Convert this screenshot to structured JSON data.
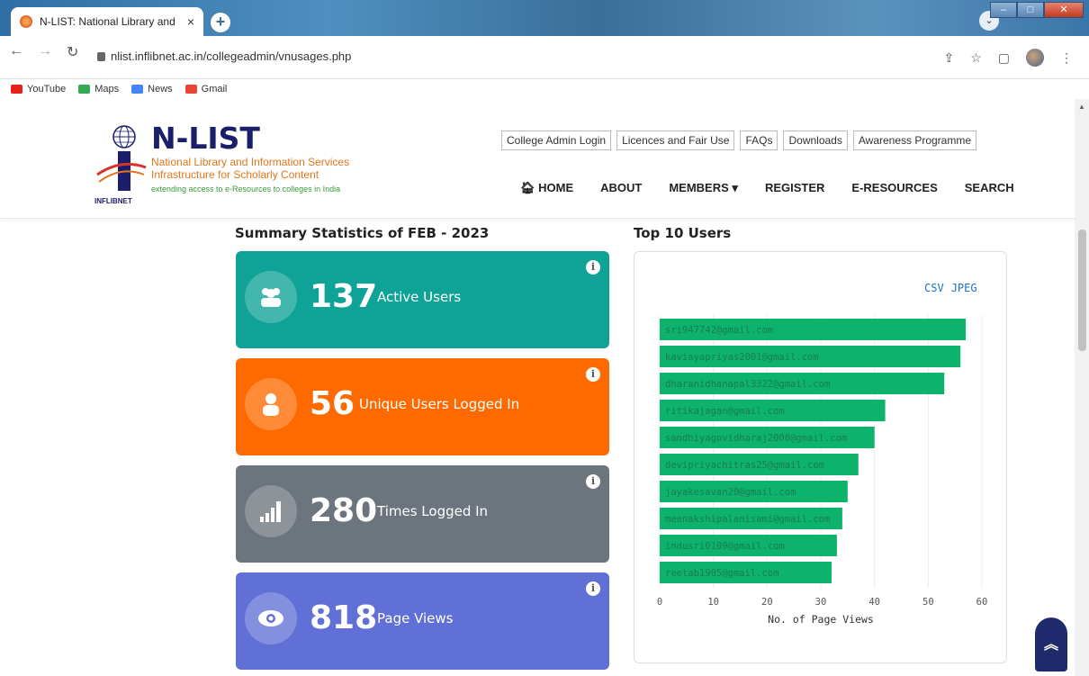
{
  "browser": {
    "tab_title": "N-LIST: National Library and Info",
    "tab_close": "×",
    "new_tab": "+",
    "url": "nlist.inflibnet.ac.in/collegeadmin/vnusages.php",
    "bookmarks": [
      {
        "label": "YouTube",
        "icon": "youtube-icon",
        "color": "#e62117"
      },
      {
        "label": "Maps",
        "icon": "maps-icon",
        "color": "#34a853"
      },
      {
        "label": "News",
        "icon": "news-icon",
        "color": "#4285f4"
      },
      {
        "label": "Gmail",
        "icon": "gmail-icon",
        "color": "#ea4335"
      }
    ]
  },
  "site": {
    "brand_name": "N-LIST",
    "brand_line1": "National Library and Information Services",
    "brand_line2": "Infrastructure for Scholarly Content",
    "brand_tagline": "extending access to e-Resources to colleges in India",
    "logo_text": "INFLIBNET",
    "top_links": [
      "College Admin Login",
      "Licences and Fair Use",
      "FAQs",
      "Downloads",
      "Awareness Programme"
    ],
    "nav": {
      "home": "HOME",
      "about": "ABOUT",
      "members": "MEMBERS ▾",
      "register": "REGISTER",
      "eresources": "E-RESOURCES",
      "search": "SEARCH"
    }
  },
  "summary": {
    "title": "Summary Statistics of FEB - 2023",
    "cards": [
      {
        "value": "137",
        "label": "Active Users",
        "color": "#0fa397",
        "icon": "users-icon"
      },
      {
        "value": "56",
        "label": "Unique Users Logged In",
        "color": "#ff6a00",
        "icon": "user-icon"
      },
      {
        "value": "280",
        "label": "Times Logged In",
        "color": "#6c757d",
        "icon": "signal-icon"
      },
      {
        "value": "818",
        "label": "Page Views",
        "color": "#6170d6",
        "icon": "eye-icon"
      }
    ],
    "info_glyph": "i"
  },
  "top_users": {
    "title": "Top 10 Users",
    "csv_label": "CSV",
    "jpeg_label": "JPEG"
  },
  "chart_data": {
    "type": "bar",
    "orientation": "horizontal",
    "categories": [
      "sri947742@gmail.com",
      "kaviayapriyas2001@gmail.com",
      "dharanidhanapal3322@gmail.com",
      "ritikajagan@gmail.com",
      "sandhiyagovidharaj2000@gmail.com",
      "devipriyachitras25@gmail.com",
      "jayakesavan20@gmail.com",
      "meenakshipalanisami@gmail.com",
      "indusri0109@gmail.com",
      "reetab1905@gmail.com"
    ],
    "values": [
      57,
      56,
      53,
      42,
      40,
      37,
      35,
      34,
      33,
      32
    ],
    "xlabel": "No. of Page Views",
    "xticks": [
      0,
      10,
      20,
      30,
      40,
      50,
      60
    ],
    "xlim": [
      0,
      60
    ],
    "bar_color": "#0db36b",
    "label_color": "#1a7d4d"
  }
}
